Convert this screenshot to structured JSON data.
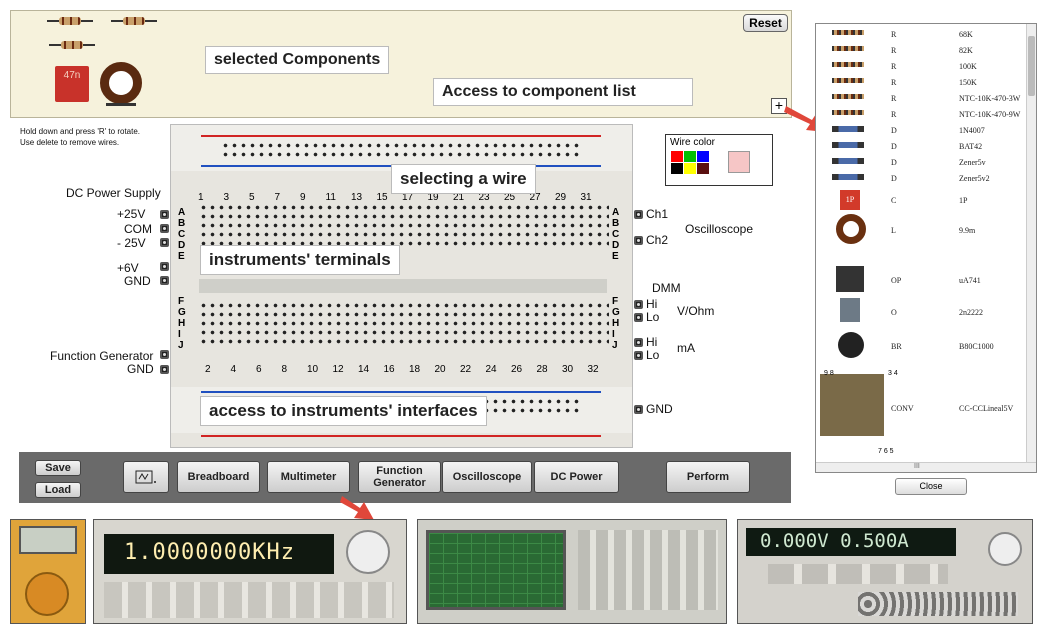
{
  "selected_panel": {
    "reset_label": "Reset",
    "plus_label": "+",
    "capacitor_label": "47n",
    "callout_selected": "selected Components",
    "callout_access_list": "Access to component list"
  },
  "hints": {
    "rotate": "Hold down and press 'R' to rotate.",
    "delete": "Use delete to remove wires."
  },
  "power_supply": {
    "title": "DC Power Supply",
    "p25": "+25V",
    "com": "COM",
    "m25": "- 25V",
    "p6": "+6V",
    "gnd": "GND"
  },
  "function_generator": {
    "label": "Function Generator",
    "gnd": "GND"
  },
  "breadboard": {
    "top_numbers": [
      "1",
      "3",
      "5",
      "7",
      "9",
      "11",
      "13",
      "15",
      "17",
      "19",
      "21",
      "23",
      "25",
      "27",
      "29",
      "31"
    ],
    "bottom_numbers": [
      "2",
      "4",
      "6",
      "8",
      "10",
      "12",
      "14",
      "16",
      "18",
      "20",
      "22",
      "24",
      "26",
      "28",
      "30",
      "32"
    ],
    "rows_top": [
      "A",
      "B",
      "C",
      "D",
      "E"
    ],
    "rows_bottom": [
      "F",
      "G",
      "H",
      "I",
      "J"
    ],
    "callout_wire": "selecting a wire",
    "callout_terminals": "instruments' terminals",
    "callout_interfaces": "access to instruments' interfaces"
  },
  "wire_color": {
    "title": "Wire color",
    "colors": [
      "#ff0000",
      "#00c000",
      "#0000ff",
      "#000000",
      "#ffff00",
      "#5a1010"
    ],
    "selected": "#f6c6c6"
  },
  "oscilloscope": {
    "ch1": "Ch1",
    "ch2": "Ch2",
    "label": "Oscilloscope"
  },
  "dmm": {
    "label": "DMM",
    "hi": "Hi",
    "lo": "Lo",
    "vohm": "V/Ohm",
    "ma": "mA",
    "hi2": "Hi",
    "lo2": "Lo",
    "gnd": "GND"
  },
  "toolbar": {
    "save": "Save",
    "load": "Load",
    "breadboard": "Breadboard",
    "multimeter": "Multimeter",
    "function_generator": "Function Generator",
    "oscilloscope": "Oscilloscope",
    "dc_power": "DC Power",
    "perform": "Perform"
  },
  "component_list": {
    "rows": [
      {
        "type": "R",
        "value": "68K"
      },
      {
        "type": "R",
        "value": "82K"
      },
      {
        "type": "R",
        "value": "100K"
      },
      {
        "type": "R",
        "value": "150K"
      },
      {
        "type": "R",
        "value": "NTC-10K-470-3W"
      },
      {
        "type": "R",
        "value": "NTC-10K-470-9W"
      },
      {
        "type": "D",
        "value": "1N4007"
      },
      {
        "type": "D",
        "value": "BAT42"
      },
      {
        "type": "D",
        "value": "Zener5v"
      },
      {
        "type": "D",
        "value": "Zener5v2"
      },
      {
        "type": "C",
        "value": "1P"
      },
      {
        "type": "L",
        "value": "9.9m"
      },
      {
        "type": "OP",
        "value": "uA741"
      },
      {
        "type": "O",
        "value": "2n2222"
      },
      {
        "type": "BR",
        "value": "B80C1000"
      },
      {
        "type": "CONV",
        "value": "CC-CCLineal5V"
      }
    ],
    "cap_icon_label": "1P",
    "pin_top": "9 8",
    "pin_top_right": "3 4",
    "pin_bottom": "7 6 5",
    "scroll_mid": "III",
    "close": "Close"
  },
  "instruments": {
    "fgen_display": "1.0000000KHz",
    "dc_display": "0.000V 0.500A"
  }
}
